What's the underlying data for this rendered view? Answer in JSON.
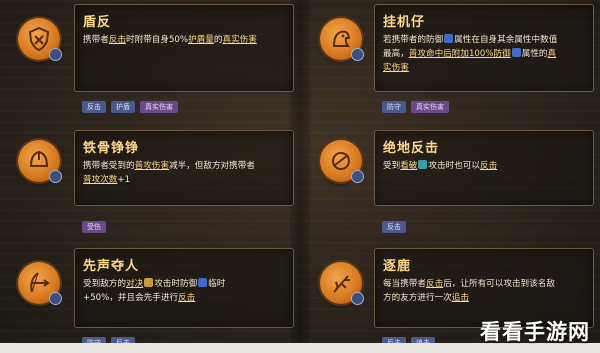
{
  "left": [
    {
      "title": "盾反",
      "desc": [
        {
          "t": "携带者"
        },
        {
          "t": "反击",
          "u": true
        },
        {
          "t": "时附带自身50%"
        },
        {
          "t": "护盾量",
          "u": true
        },
        {
          "t": "的"
        },
        {
          "t": "真实伤害",
          "u": true
        }
      ],
      "tags": [
        {
          "label": "反击",
          "color": "blue"
        },
        {
          "label": "护盾",
          "color": "blue"
        },
        {
          "label": "真实伤害",
          "color": "purple"
        }
      ]
    },
    {
      "title": "铁骨铮铮",
      "desc": [
        {
          "t": "携带者受到的"
        },
        {
          "t": "普攻伤害",
          "u": true
        },
        {
          "t": "减半，但敌方对携带者"
        },
        {
          "br": true
        },
        {
          "t": "普攻次数",
          "u": true
        },
        {
          "t": "+1"
        }
      ],
      "tags": [
        {
          "label": "受伤",
          "color": "purple"
        }
      ]
    },
    {
      "title": "先声夺人",
      "desc": [
        {
          "t": "受到敌方的"
        },
        {
          "t": "对决",
          "u": true
        },
        {
          "icon": "sword"
        },
        {
          "t": "攻击时防御"
        },
        {
          "icon": "shield"
        },
        {
          "t": "临时"
        },
        {
          "br": true
        },
        {
          "t": "+50%，并且会先手进行"
        },
        {
          "t": "反击",
          "u": true
        }
      ],
      "tags": [
        {
          "label": "防守",
          "color": "blue"
        },
        {
          "label": "反击",
          "color": "blue"
        }
      ]
    }
  ],
  "right": [
    {
      "title": "挂机仔",
      "desc": [
        {
          "t": "若携带者的防御"
        },
        {
          "icon": "shield"
        },
        {
          "t": "属性在自身其余属性中数值"
        },
        {
          "br": true
        },
        {
          "t": "最高，"
        },
        {
          "t": "普攻命中后附加100%防御",
          "u": true
        },
        {
          "icon": "shield"
        },
        {
          "t": "属性的"
        },
        {
          "t": "真",
          "u": true
        },
        {
          "br": true
        },
        {
          "t": "实伤害",
          "u": true
        }
      ],
      "tags": [
        {
          "label": "防守",
          "color": "blue"
        },
        {
          "label": "真实伤害",
          "color": "purple"
        }
      ]
    },
    {
      "title": "绝地反击",
      "desc": [
        {
          "t": "受到"
        },
        {
          "t": "看破",
          "u": true
        },
        {
          "icon": "eye"
        },
        {
          "t": "攻击时也可以"
        },
        {
          "t": "反击",
          "u": true
        }
      ],
      "tags": [
        {
          "label": "反击",
          "color": "blue"
        }
      ]
    },
    {
      "title": "逐鹿",
      "desc": [
        {
          "t": "每当携带者"
        },
        {
          "t": "反击",
          "u": true
        },
        {
          "t": "后，让所有可以攻击到该名敌"
        },
        {
          "br": true
        },
        {
          "t": "方的友方进行一次"
        },
        {
          "t": "追击",
          "u": true
        }
      ],
      "tags": [
        {
          "label": "反击",
          "color": "blue"
        },
        {
          "label": "追击",
          "color": "blue"
        }
      ]
    }
  ],
  "watermark": "看看手游网"
}
